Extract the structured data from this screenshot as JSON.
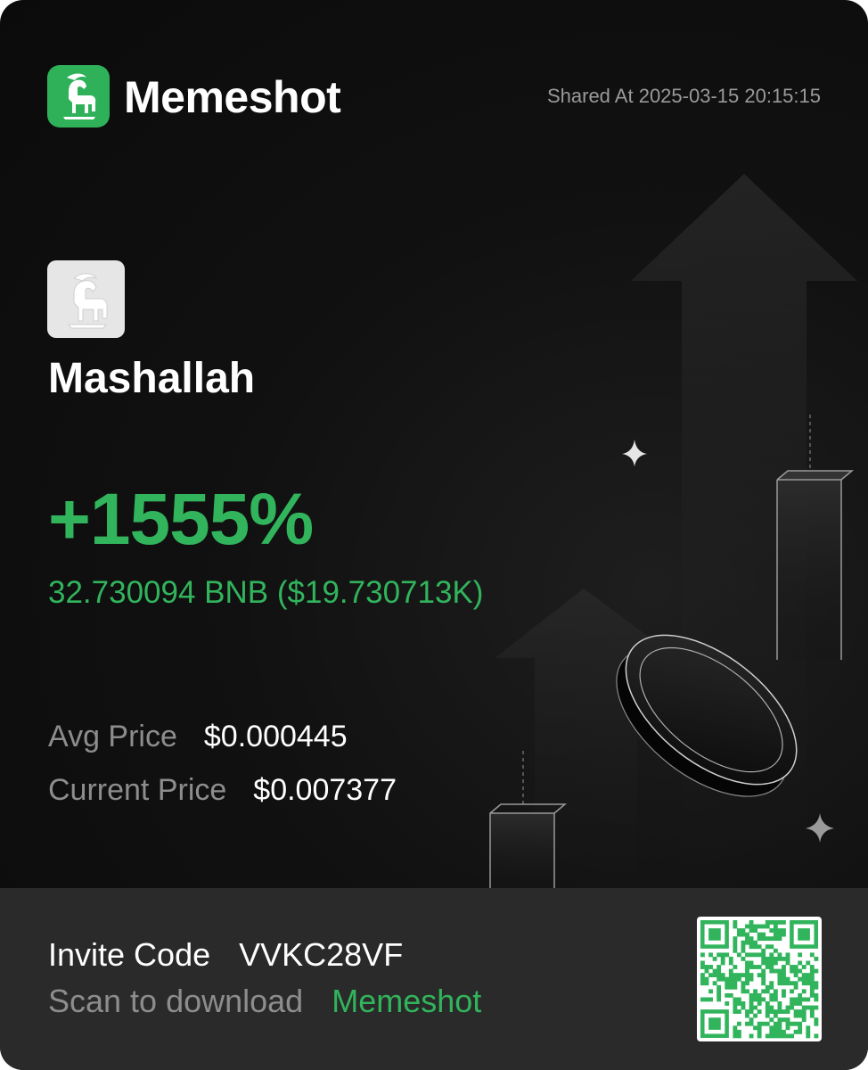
{
  "header": {
    "brand": "Memeshot",
    "shared_at": "Shared At 2025-03-15 20:15:15",
    "logo_icon": "goat-icon"
  },
  "token": {
    "name": "Mashallah",
    "avatar_icon": "goat-icon"
  },
  "pnl": {
    "percent": "+1555%",
    "amount": "32.730094 BNB ($19.730713K)"
  },
  "prices": {
    "avg_label": "Avg Price",
    "avg_value": "$0.000445",
    "current_label": "Current Price",
    "current_value": "$0.007377"
  },
  "footer": {
    "invite_label": "Invite Code",
    "invite_code": "VVKC28VF",
    "scan_label": "Scan to download",
    "scan_app": "Memeshot",
    "qr_icon": "qr-code-icon"
  },
  "colors": {
    "accent": "#31b45c",
    "background": "#111111",
    "footer": "#2a2a2a"
  }
}
